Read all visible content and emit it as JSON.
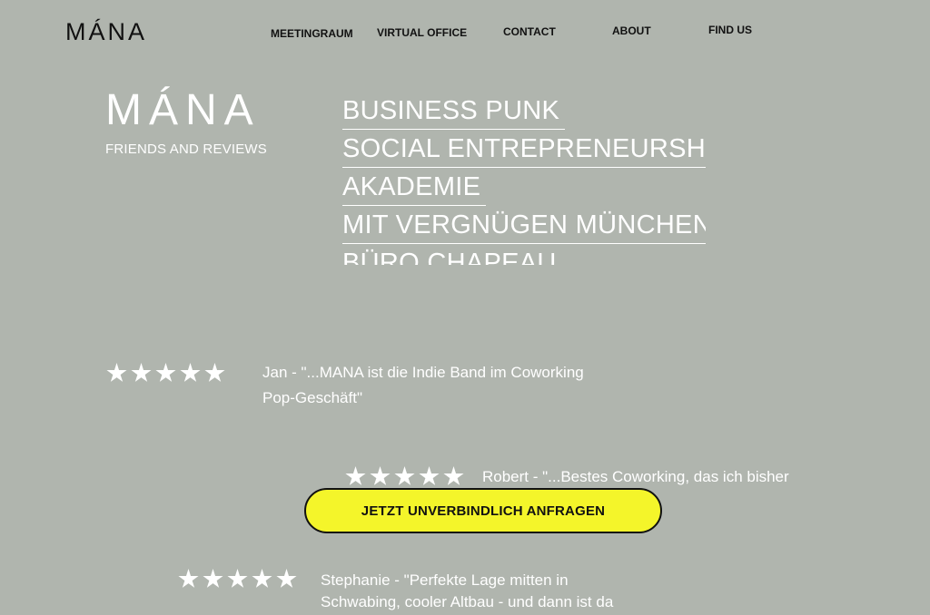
{
  "nav": {
    "logo": "MÁNA",
    "items": [
      {
        "label": "MEETINGRAUM"
      },
      {
        "label": "VIRTUAL OFFICE"
      },
      {
        "label": "CONTACT"
      },
      {
        "label": "ABOUT"
      },
      {
        "label": "FIND US"
      }
    ]
  },
  "brand": {
    "logo": "MÁNA",
    "subtitle": "FRIENDS AND REVIEWS"
  },
  "partners": [
    "BUSINESS PUNK",
    "SOCIAL ENTREPRENEURSHIP",
    "AKADEMIE",
    "MIT VERGNÜGEN MÜNCHEN",
    "BÜRO CHAPEAU"
  ],
  "reviews": [
    {
      "rating": 5,
      "lines": [
        "Jan - \"...MANA ist die Indie Band im Coworking",
        "Pop-Geschäft\""
      ]
    },
    {
      "rating": 5,
      "lines": [
        "Robert - \"...Bestes Coworking, das ich bisher",
        ""
      ]
    },
    {
      "rating": 5,
      "lines": [
        "Stephanie - \"Perfekte Lage mitten in",
        "Schwabing, cooler Altbau - und dann ist da"
      ]
    }
  ],
  "cta": {
    "label": "JETZT UNVERBINDLICH ANFRAGEN"
  },
  "colors": {
    "background": "#b0b5ae",
    "cta": "#f4f52a",
    "text_dark": "#111111",
    "text_light": "#ffffff"
  }
}
